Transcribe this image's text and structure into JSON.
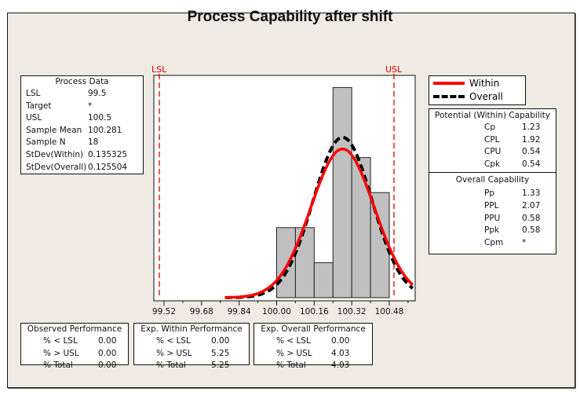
{
  "title": "Process Capability after shift",
  "colors": {
    "within_curve": "#ff0000",
    "overall_curve": "#000000",
    "spec_lines": "#e00000",
    "bars": "#c0c0c0",
    "background": "#efebe2"
  },
  "legend": {
    "items": [
      {
        "label": "Within",
        "style": "solid",
        "color": "#ff0000"
      },
      {
        "label": "Overall",
        "style": "dashed",
        "color": "#000000"
      }
    ]
  },
  "process_data": {
    "header": "Process Data",
    "rows": [
      {
        "label": "LSL",
        "value": "99.5"
      },
      {
        "label": "Target",
        "value": "*"
      },
      {
        "label": "USL",
        "value": "100.5"
      },
      {
        "label": "Sample Mean",
        "value": "100.281"
      },
      {
        "label": "Sample N",
        "value": "18"
      },
      {
        "label": "StDev(Within)",
        "value": "0.135325"
      },
      {
        "label": "StDev(Overall)",
        "value": "0.125504"
      }
    ]
  },
  "potential_capability": {
    "header": "Potential (Within) Capability",
    "rows": [
      {
        "label": "Cp",
        "value": "1.23"
      },
      {
        "label": "CPL",
        "value": "1.92"
      },
      {
        "label": "CPU",
        "value": "0.54"
      },
      {
        "label": "Cpk",
        "value": "0.54"
      }
    ]
  },
  "overall_capability": {
    "header": "Overall Capability",
    "rows": [
      {
        "label": "Pp",
        "value": "1.33"
      },
      {
        "label": "PPL",
        "value": "2.07"
      },
      {
        "label": "PPU",
        "value": "0.58"
      },
      {
        "label": "Ppk",
        "value": "0.58"
      },
      {
        "label": "Cpm",
        "value": "*"
      }
    ]
  },
  "observed_performance": {
    "header": "Observed Performance",
    "rows": [
      {
        "label": "% < LSL",
        "value": "0.00"
      },
      {
        "label": "% > USL",
        "value": "0.00"
      },
      {
        "label": "% Total",
        "value": "0.00"
      }
    ]
  },
  "exp_within_performance": {
    "header": "Exp. Within Performance",
    "rows": [
      {
        "label": "% < LSL",
        "value": "0.00"
      },
      {
        "label": "% > USL",
        "value": "5.25"
      },
      {
        "label": "% Total",
        "value": "5.25"
      }
    ]
  },
  "exp_overall_performance": {
    "header": "Exp. Overall Performance",
    "rows": [
      {
        "label": "% < LSL",
        "value": "0.00"
      },
      {
        "label": "% > USL",
        "value": "4.03"
      },
      {
        "label": "% Total",
        "value": "4.03"
      }
    ]
  },
  "chart_data": {
    "type": "bar",
    "title": "Process Capability after shift",
    "xlabel": "",
    "ylabel": "",
    "bins": [
      {
        "start": 100.0,
        "end": 100.08,
        "count": 2
      },
      {
        "start": 100.08,
        "end": 100.16,
        "count": 2
      },
      {
        "start": 100.16,
        "end": 100.24,
        "count": 1
      },
      {
        "start": 100.24,
        "end": 100.32,
        "count": 6
      },
      {
        "start": 100.32,
        "end": 100.4,
        "count": 4
      },
      {
        "start": 100.4,
        "end": 100.48,
        "count": 3
      }
    ],
    "x_ticks": [
      "99.52",
      "99.68",
      "99.84",
      "100.00",
      "100.16",
      "100.32",
      "100.48"
    ],
    "xlim": [
      99.47,
      100.58
    ],
    "ylim": [
      0,
      6.3
    ],
    "spec_limits": [
      {
        "label": "LSL",
        "value": 99.5
      },
      {
        "label": "USL",
        "value": 100.5
      }
    ],
    "series": [
      {
        "name": "Within",
        "type": "normal-curve",
        "mean": 100.281,
        "stdev": 0.135325,
        "n": 18,
        "bin_width": 0.08
      },
      {
        "name": "Overall",
        "type": "normal-curve",
        "mean": 100.281,
        "stdev": 0.125504,
        "n": 18,
        "bin_width": 0.08
      }
    ],
    "grid": false,
    "legend_position": "right"
  }
}
